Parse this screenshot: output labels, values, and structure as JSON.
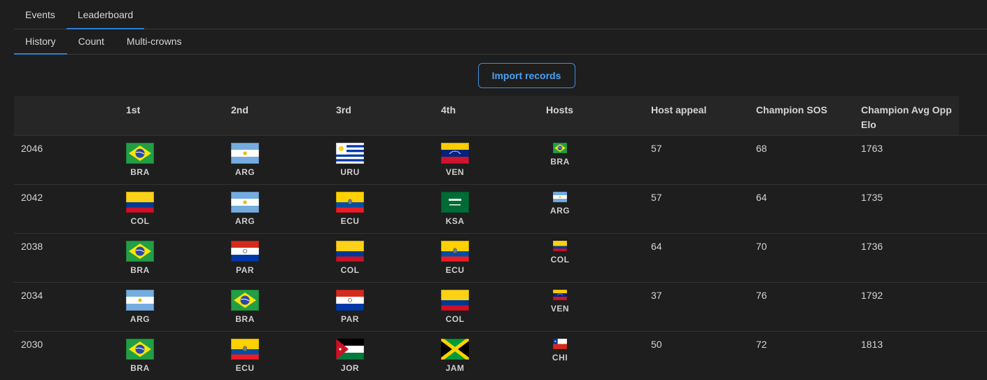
{
  "tabs_top": [
    "Events",
    "Leaderboard"
  ],
  "tabs_top_active": 1,
  "tabs_sub": [
    "History",
    "Count",
    "Multi-crowns"
  ],
  "tabs_sub_active": 0,
  "import_label": "Import records",
  "columns": [
    "",
    "1st",
    "2nd",
    "3rd",
    "4th",
    "Hosts",
    "Host appeal",
    "Champion SOS",
    "Champion Avg Opp Elo"
  ],
  "rows": [
    {
      "year": "2046",
      "places": [
        "BRA",
        "ARG",
        "URU",
        "VEN"
      ],
      "host": "BRA",
      "host_appeal": "57",
      "sos": "68",
      "elo": "1763"
    },
    {
      "year": "2042",
      "places": [
        "COL",
        "ARG",
        "ECU",
        "KSA"
      ],
      "host": "ARG",
      "host_appeal": "57",
      "sos": "64",
      "elo": "1735"
    },
    {
      "year": "2038",
      "places": [
        "BRA",
        "PAR",
        "COL",
        "ECU"
      ],
      "host": "COL",
      "host_appeal": "64",
      "sos": "70",
      "elo": "1736"
    },
    {
      "year": "2034",
      "places": [
        "ARG",
        "BRA",
        "PAR",
        "COL"
      ],
      "host": "VEN",
      "host_appeal": "37",
      "sos": "76",
      "elo": "1792"
    },
    {
      "year": "2030",
      "places": [
        "BRA",
        "ECU",
        "JOR",
        "JAM"
      ],
      "host": "CHI",
      "host_appeal": "50",
      "sos": "72",
      "elo": "1813"
    }
  ],
  "flag_icons": {
    "BRA": "brazil-flag-icon",
    "ARG": "argentina-flag-icon",
    "URU": "uruguay-flag-icon",
    "VEN": "venezuela-flag-icon",
    "COL": "colombia-flag-icon",
    "ECU": "ecuador-flag-icon",
    "KSA": "saudi-arabia-flag-icon",
    "PAR": "paraguay-flag-icon",
    "JOR": "jordan-flag-icon",
    "JAM": "jamaica-flag-icon",
    "CHI": "chile-flag-icon"
  },
  "colors": {
    "accent": "#2d7fd3",
    "button_text": "#4aa0f0",
    "background": "#1e1e1e",
    "header_bg": "#262626"
  }
}
